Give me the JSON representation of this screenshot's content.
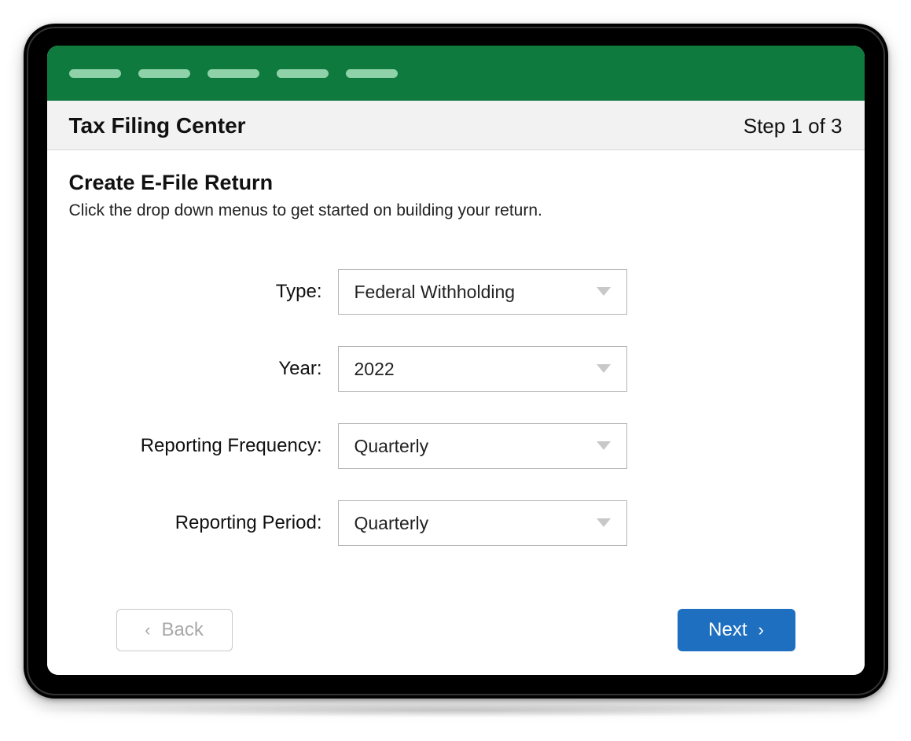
{
  "header": {
    "title": "Tax Filing Center",
    "step": "Step 1 of 3"
  },
  "section": {
    "title": "Create E-File Return",
    "subtitle": "Click the drop down menus to get started on building your return."
  },
  "form": {
    "type": {
      "label": "Type:",
      "value": "Federal Withholding"
    },
    "year": {
      "label": "Year:",
      "value": "2022"
    },
    "frequency": {
      "label": "Reporting Frequency:",
      "value": "Quarterly"
    },
    "period": {
      "label": "Reporting Period:",
      "value": "Quarterly"
    }
  },
  "buttons": {
    "back": "Back",
    "next": "Next"
  },
  "colors": {
    "bannerGreen": "#0f7a3d",
    "pillGreen": "#8fd1a8",
    "nextBlue": "#1f6fc0"
  }
}
